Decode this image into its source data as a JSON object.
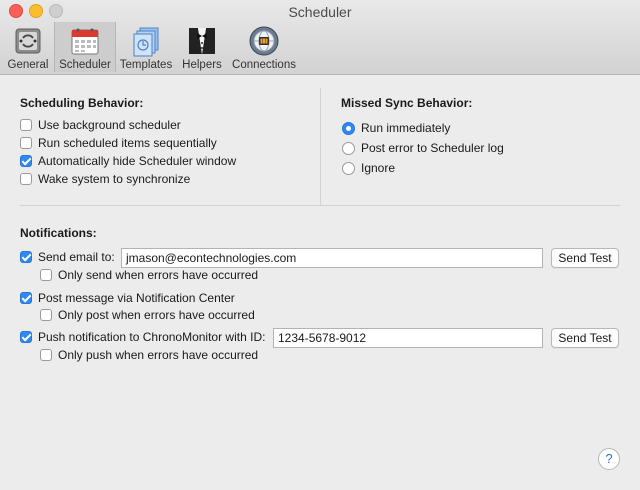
{
  "window": {
    "title": "Scheduler"
  },
  "toolbar": {
    "items": [
      {
        "label": "General",
        "icon": "general-switch-icon"
      },
      {
        "label": "Scheduler",
        "icon": "calendar-icon",
        "selected": true
      },
      {
        "label": "Templates",
        "icon": "templates-icon"
      },
      {
        "label": "Helpers",
        "icon": "tuxedo-helper-icon"
      },
      {
        "label": "Connections",
        "icon": "connections-globe-icon"
      }
    ]
  },
  "scheduling": {
    "heading": "Scheduling Behavior:",
    "options": [
      {
        "label": "Use background scheduler",
        "checked": false
      },
      {
        "label": "Run scheduled items sequentially",
        "checked": false
      },
      {
        "label": "Automatically hide Scheduler window",
        "checked": true
      },
      {
        "label": "Wake system to synchronize",
        "checked": false
      }
    ]
  },
  "missed_sync": {
    "heading": "Missed Sync Behavior:",
    "options": [
      {
        "label": "Run immediately",
        "selected": true
      },
      {
        "label": "Post error to Scheduler log",
        "selected": false
      },
      {
        "label": "Ignore",
        "selected": false
      }
    ]
  },
  "notifications": {
    "heading": "Notifications:",
    "email": {
      "label": "Send email to:",
      "checked": true,
      "value": "jmason@econtechnologies.com",
      "test_label": "Send Test"
    },
    "email_errors": {
      "label": "Only send when errors have occurred",
      "checked": false
    },
    "notification_center": {
      "label": "Post message via Notification Center",
      "checked": true
    },
    "nc_errors": {
      "label": "Only post when errors have occurred",
      "checked": false
    },
    "push": {
      "label": "Push notification to ChronoMonitor with ID:",
      "checked": true,
      "value": "1234-5678-9012",
      "test_label": "Send Test"
    },
    "push_errors": {
      "label": "Only push when errors have occurred",
      "checked": false
    }
  },
  "help": {
    "label": "?"
  },
  "colors": {
    "accent": "#2f88f3",
    "toolbar_bg": "#dcdcdc",
    "window_bg": "#ececec"
  }
}
